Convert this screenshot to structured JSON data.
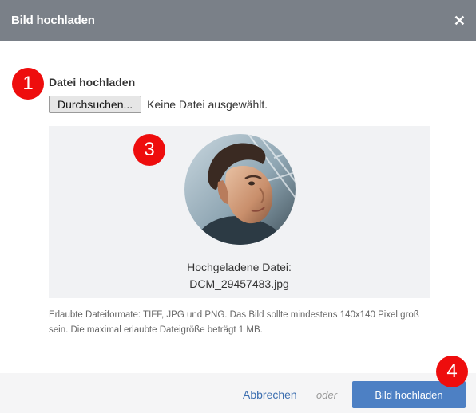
{
  "dialog": {
    "title": "Bild hochladen",
    "close_icon": "close-icon"
  },
  "upload": {
    "label": "Datei hochladen",
    "browse_label": "Durchsuchen...",
    "status": "Keine Datei ausgewählt."
  },
  "preview": {
    "caption_line1": "Hochgeladene Datei:",
    "caption_line2": "DCM_29457483.jpg"
  },
  "hint": "Erlaubte Dateiformate: TIFF, JPG und PNG. Das Bild sollte mindestens 140x140 Pixel groß sein. Die maximal erlaubte Dateigröße beträgt 1 MB.",
  "footer": {
    "cancel_label": "Abbrechen",
    "or_label": "oder",
    "submit_label": "Bild hochladen"
  },
  "markers": [
    "1",
    "3",
    "4"
  ],
  "colors": {
    "header": "#7a8088",
    "marker": "#ee0d0d",
    "primary": "#4d80c4",
    "link": "#3d6fb0",
    "preview_bg": "#f1f2f4"
  }
}
